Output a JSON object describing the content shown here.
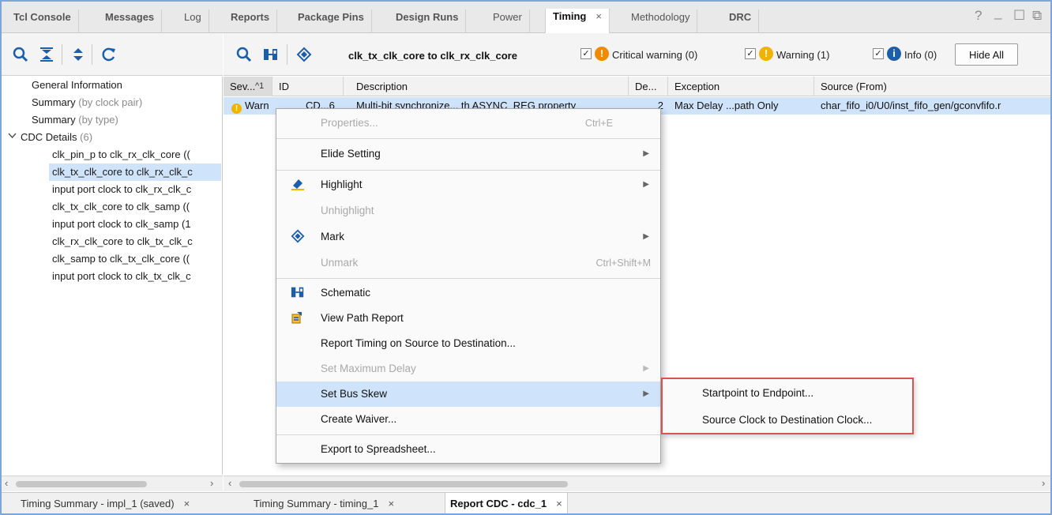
{
  "top_tabs": [
    {
      "label": "Tcl Console"
    },
    {
      "label": "Messages"
    },
    {
      "label": "Log"
    },
    {
      "label": "Reports"
    },
    {
      "label": "Package Pins"
    },
    {
      "label": "Design Runs"
    },
    {
      "label": "Power"
    },
    {
      "label": "Timing",
      "active": true,
      "close": "×"
    },
    {
      "label": "Methodology"
    },
    {
      "label": "DRC"
    }
  ],
  "window_controls": {
    "help": "?",
    "minimize": "_",
    "restore": "☐",
    "float": "⧉"
  },
  "toolbar": {
    "clock_pair_title": "clk_tx_clk_core to clk_rx_clk_core",
    "critical_warning_label": "Critical warning (0)",
    "warning_label": "Warning (1)",
    "info_label": "Info (0)",
    "hide_all_label": "Hide All",
    "checked_mark": "✓",
    "critical_color": "#f08a00",
    "warning_color": "#f0b400",
    "info_color": "#1d5ea8"
  },
  "tree": {
    "items": [
      {
        "label": "General Information",
        "suffix": ""
      },
      {
        "label": "Summary",
        "suffix": "(by clock pair)"
      },
      {
        "label": "Summary",
        "suffix": "(by type)"
      },
      {
        "label": "CDC Details",
        "suffix": "(6)"
      },
      {
        "label": "clk_pin_p to clk_rx_clk_core (("
      },
      {
        "label": "clk_tx_clk_core to clk_rx_clk_c"
      },
      {
        "label": "input port clock to clk_rx_clk_c"
      },
      {
        "label": "clk_tx_clk_core to clk_samp (("
      },
      {
        "label": "input port clock to clk_samp (1"
      },
      {
        "label": "clk_rx_clk_core to clk_tx_clk_c"
      },
      {
        "label": "clk_samp to clk_tx_clk_core (("
      },
      {
        "label": "input port clock to clk_tx_clk_c"
      }
    ]
  },
  "table": {
    "headers": [
      "Sev...",
      "^1",
      "ID",
      "Description",
      "De...",
      "Exception",
      "Source (From)"
    ],
    "row": {
      "severity": "Warn",
      "id": "CD...6",
      "description": "Multi-bit synchronize... th ASYNC_REG property",
      "depth": "2",
      "exception": "Max Delay ...path Only",
      "source": "char_fifo_i0/U0/inst_fifo_gen/gconvfifo.r"
    }
  },
  "context_menu": {
    "items": [
      {
        "label": "Properties...",
        "shortcut": "Ctrl+E",
        "disabled": true
      },
      {
        "label": "Elide Setting",
        "submenu": "▶"
      },
      {
        "label": "Highlight",
        "submenu": "▶",
        "icon": "highlight-icon"
      },
      {
        "label": "Unhighlight",
        "disabled": true
      },
      {
        "label": "Mark",
        "submenu": "▶",
        "icon": "mark-icon"
      },
      {
        "label": "Unmark",
        "shortcut": "Ctrl+Shift+M",
        "disabled": true
      },
      {
        "label": "Schematic",
        "icon": "schematic-icon"
      },
      {
        "label": "View Path Report",
        "icon": "path-report-icon"
      },
      {
        "label": "Report Timing on Source to Destination..."
      },
      {
        "label": "Set Maximum Delay",
        "submenu": "▶",
        "disabled": true
      },
      {
        "label": "Set Bus Skew",
        "submenu": "▶",
        "highlighted": true
      },
      {
        "label": "Create Waiver..."
      },
      {
        "label": "Export to Spreadsheet..."
      }
    ]
  },
  "submenu": {
    "items": [
      {
        "label": "Startpoint to Endpoint..."
      },
      {
        "label": "Source Clock to Destination Clock..."
      }
    ],
    "outline_color": "#d9534f"
  },
  "bottom_tabs": [
    {
      "label": "Timing Summary - impl_1 (saved)",
      "close": "×"
    },
    {
      "label": "Timing Summary - timing_1",
      "close": "×"
    },
    {
      "label": "Report CDC - cdc_1",
      "close": "×",
      "active": true
    }
  ]
}
